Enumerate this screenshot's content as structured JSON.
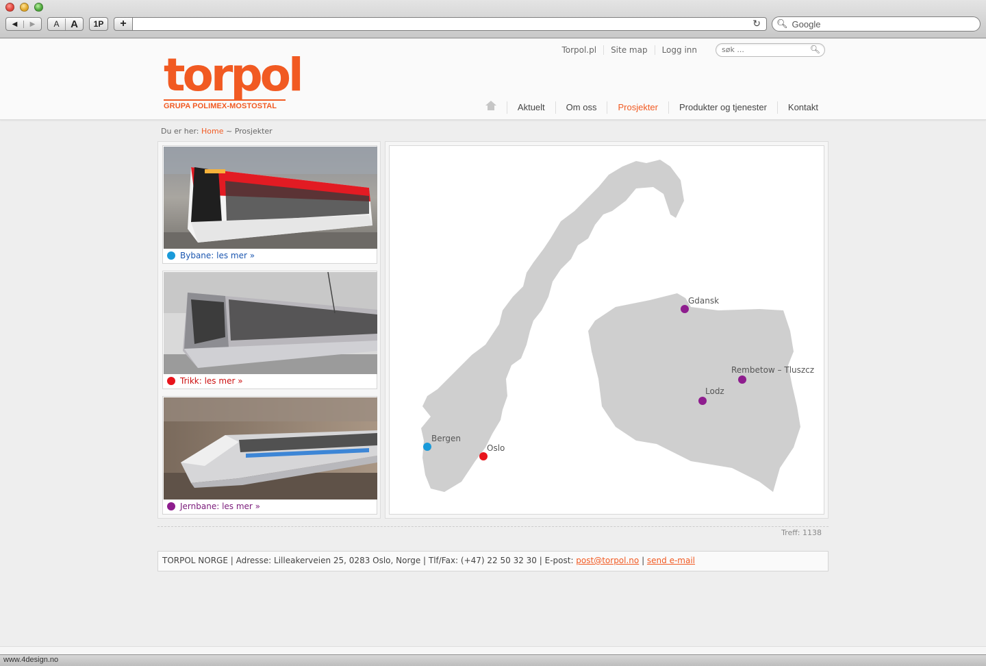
{
  "browser": {
    "nav_back": "◀",
    "nav_forward": "▶",
    "font_small": "A",
    "font_large": "A",
    "onepassword": "1P",
    "new_tab": "+",
    "reload": "↻",
    "search_placeholder": "Google"
  },
  "header": {
    "logo_word": "torpol",
    "logo_sub": "GRUPA POLIMEX-MOSTOSTAL",
    "top_links": [
      "Torpol.pl",
      "Site map",
      "Logg inn"
    ],
    "search_placeholder": "søk ...",
    "nav": [
      {
        "label": "Aktuelt",
        "active": false
      },
      {
        "label": "Om oss",
        "active": false
      },
      {
        "label": "Prosjekter",
        "active": true
      },
      {
        "label": "Produkter og tjenester",
        "active": false
      },
      {
        "label": "Kontakt",
        "active": false
      }
    ]
  },
  "breadcrumb": {
    "prefix": "Du er her:",
    "home": "Home",
    "separator": "~",
    "current": "Prosjekter"
  },
  "projects": [
    {
      "caption": "Bybane: les mer »",
      "color": "#1a9ad9",
      "text_color": "#1a56b0"
    },
    {
      "caption": "Trikk: les mer »",
      "color": "#e8141c",
      "text_color": "#cc1010"
    },
    {
      "caption": "Jernbane: les mer »",
      "color": "#8e1d8e",
      "text_color": "#7a1a7a"
    }
  ],
  "map": {
    "cities": [
      {
        "name": "Bergen",
        "color": "#1a9ad9"
      },
      {
        "name": "Oslo",
        "color": "#e8141c"
      },
      {
        "name": "Gdansk",
        "color": "#8e1d8e"
      },
      {
        "name": "Rembetow – Tluszcz",
        "color": "#8e1d8e"
      },
      {
        "name": "Lodz",
        "color": "#8e1d8e"
      }
    ]
  },
  "treff": "Treff: 1138",
  "footer": {
    "text": "TORPOL NORGE | Adresse: Lilleakerveien 25, 0283 Oslo, Norge | Tlf/Fax: (+47) 22 50 32 30 | E-post: ",
    "email": "post@torpol.no",
    "sep": " | ",
    "send": "send e-mail"
  },
  "statusbar": "www.4design.no",
  "colors": {
    "accent": "#f15a22",
    "map_land": "#cfcfcf"
  }
}
